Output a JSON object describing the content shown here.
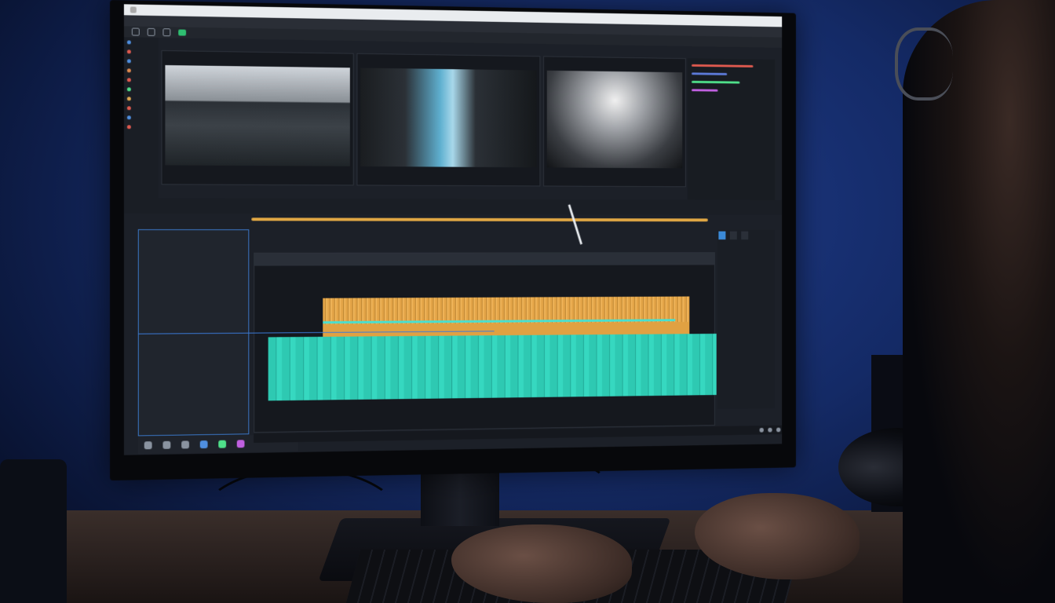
{
  "colors": {
    "accent_orange": "#e3a447",
    "accent_cyan": "#2ec9b2",
    "accent_blue": "#3b78c8",
    "accent_green": "#2fbf71",
    "playhead": "#e8ecf0"
  },
  "icons": {
    "app": "app-logo-icon",
    "play": "play-icon",
    "stop": "stop-icon",
    "record": "record-icon",
    "color": "color-wheel-icon",
    "audio": "audio-icon",
    "inspector": "inspector-icon"
  }
}
